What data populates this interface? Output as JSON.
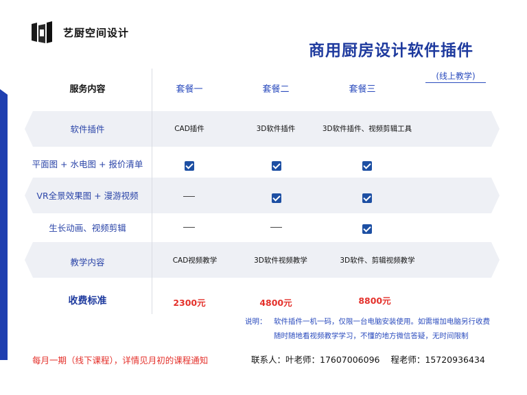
{
  "brand": {
    "name": "艺厨空间设计",
    "logo_icon": "kitchen-logo-icon"
  },
  "title": "商用厨房设计软件插件",
  "online_tag": "(线上教学)",
  "table": {
    "header": {
      "service": "服务内容",
      "plans": [
        "套餐一",
        "套餐二",
        "套餐三"
      ]
    },
    "rows": [
      {
        "label": "软件插件",
        "cells": [
          "CAD插件",
          "3D软件插件",
          "3D软件插件、视频剪辑工具"
        ]
      },
      {
        "label": "平面图 + 水电图 + 报价清单",
        "cells": [
          "check",
          "check",
          "check"
        ]
      },
      {
        "label": "VR全景效果图 + 漫游视频",
        "cells": [
          "dash",
          "check",
          "check"
        ]
      },
      {
        "label": "生长动画、视频剪辑",
        "cells": [
          "dash",
          "dash",
          "check"
        ]
      },
      {
        "label": "教学内容",
        "cells": [
          "CAD视频教学",
          "3D软件视频教学",
          "3D软件、剪辑视频教学"
        ]
      }
    ],
    "fee": {
      "label": "收费标准",
      "prices": [
        "2300元",
        "4800元",
        "8800元"
      ]
    }
  },
  "note": {
    "label": "说明：",
    "line1": "软件插件一机一码，仅限一台电脑安装使用。如需增加电脑另行收费",
    "line2": "随时随地看视频教学学习，不懂的地方微信答疑，无时间限制"
  },
  "footer": {
    "monthly": "每月一期（线下课程），详情见月初的课程通知",
    "contact": "联系人：叶老师：17607006096    程老师：15720936434"
  },
  "colors": {
    "accent_blue": "#1e3a9e",
    "price_red": "#e4312b",
    "check_blue": "#1d4fa3",
    "band_gray": "#eef0f5"
  }
}
